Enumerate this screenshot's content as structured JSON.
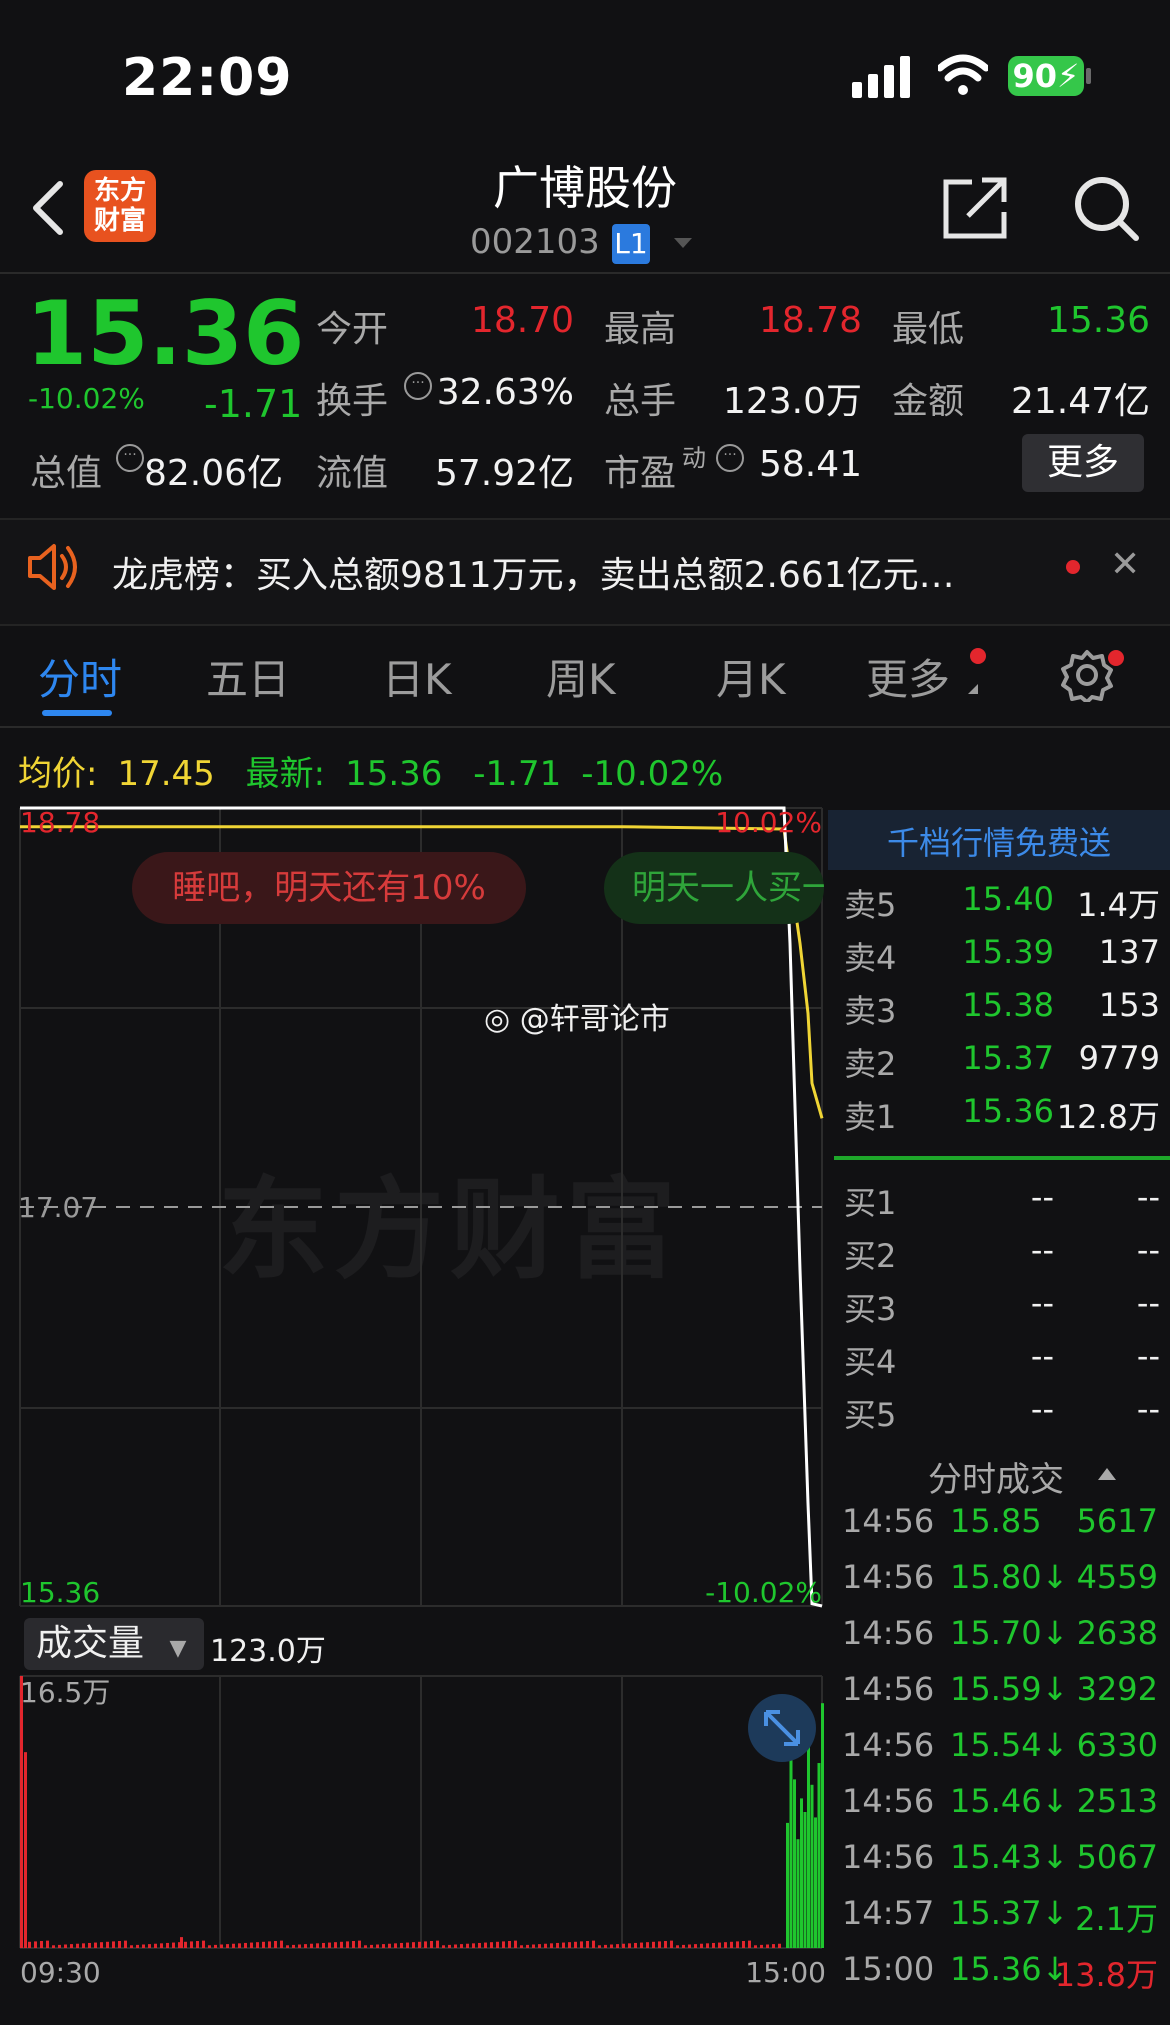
{
  "status_bar": {
    "time": "22:09",
    "battery": "90"
  },
  "header": {
    "brand": "东方财富",
    "title": "广博股份",
    "code": "002103",
    "level": "L1"
  },
  "quote": {
    "price": "15.36",
    "change_pct": "-10.02%",
    "change": "-1.71",
    "rows": [
      [
        {
          "label": "今开",
          "value": "18.70",
          "color": "red"
        },
        {
          "label": "最高",
          "value": "18.78",
          "color": "red"
        },
        {
          "label": "最低",
          "value": "15.36",
          "color": "green"
        }
      ],
      [
        {
          "label": "换手",
          "value": "32.63%",
          "color": "white"
        },
        {
          "label": "总手",
          "value": "123.0万",
          "color": "white"
        },
        {
          "label": "金额",
          "value": "21.47亿",
          "color": "white"
        }
      ],
      [
        {
          "label": "总值",
          "value": "82.06亿",
          "color": "white"
        },
        {
          "label": "流值",
          "value": "57.92亿",
          "color": "white"
        },
        {
          "label": "市盈",
          "value": "58.41",
          "color": "white",
          "sup": "动"
        }
      ]
    ],
    "more": "更多"
  },
  "news": {
    "text": "龙虎榜：买入总额9811万元，卖出总额2.661亿元…"
  },
  "tabs": [
    "分时",
    "五日",
    "日K",
    "周K",
    "月K",
    "更多"
  ],
  "legend": {
    "avg_label": "均价:",
    "avg": "17.45",
    "latest_label": "最新:",
    "latest": "15.36",
    "chg": "-1.71",
    "pct": "-10.02%"
  },
  "chart_labels": {
    "top_price": "18.78",
    "top_pct": "10.02%",
    "mid_price": "17.07",
    "bottom_price": "15.36",
    "bottom_pct": "-10.02%"
  },
  "bubbles": [
    "睡吧，明天还有10%",
    "明天一人买一"
  ],
  "watermarks": {
    "weibo": "@轩哥论市",
    "brand": "东方财富"
  },
  "volume": {
    "label": "成交量",
    "value": "123.0万",
    "max": "16.5万",
    "start_time": "09:30",
    "end_time": "15:00"
  },
  "order_book": {
    "title": "千档行情免费送",
    "asks": [
      {
        "label": "卖5",
        "price": "15.40",
        "vol": "1.4万"
      },
      {
        "label": "卖4",
        "price": "15.39",
        "vol": "137"
      },
      {
        "label": "卖3",
        "price": "15.38",
        "vol": "153"
      },
      {
        "label": "卖2",
        "price": "15.37",
        "vol": "9779"
      },
      {
        "label": "卖1",
        "price": "15.36",
        "vol": "12.8万"
      }
    ],
    "bids": [
      {
        "label": "买1",
        "price": "--",
        "vol": "--"
      },
      {
        "label": "买2",
        "price": "--",
        "vol": "--"
      },
      {
        "label": "买3",
        "price": "--",
        "vol": "--"
      },
      {
        "label": "买4",
        "price": "--",
        "vol": "--"
      },
      {
        "label": "买5",
        "price": "--",
        "vol": "--"
      }
    ]
  },
  "trades": {
    "title": "分时成交",
    "rows": [
      {
        "time": "14:56",
        "price": "15.85",
        "vol": "5617",
        "vol_color": "green"
      },
      {
        "time": "14:56",
        "price": "15.80↓",
        "vol": "4559",
        "vol_color": "green"
      },
      {
        "time": "14:56",
        "price": "15.70↓",
        "vol": "2638",
        "vol_color": "green"
      },
      {
        "time": "14:56",
        "price": "15.59↓",
        "vol": "3292",
        "vol_color": "green"
      },
      {
        "time": "14:56",
        "price": "15.54↓",
        "vol": "6330",
        "vol_color": "green"
      },
      {
        "time": "14:56",
        "price": "15.46↓",
        "vol": "2513",
        "vol_color": "green"
      },
      {
        "time": "14:56",
        "price": "15.43↓",
        "vol": "5067",
        "vol_color": "green"
      },
      {
        "time": "14:57",
        "price": "15.37↓",
        "vol": "2.1万",
        "vol_color": "green"
      },
      {
        "time": "15:00",
        "price": "15.36↓",
        "vol": "13.8万",
        "vol_color": "red"
      }
    ]
  },
  "colors": {
    "up": "#e3262d",
    "down": "#1fc62e",
    "avg_line": "#f0d535",
    "price_line": "#ffffff",
    "accent": "#2e87f0"
  },
  "chart_data": {
    "type": "line",
    "title": "",
    "ylim": [
      15.36,
      18.78
    ],
    "reference_price": 17.07,
    "x": [
      "09:30",
      "10:30",
      "11:30",
      "13:00",
      "14:00",
      "14:53",
      "14:54",
      "14:55",
      "14:56",
      "14:57",
      "15:00"
    ],
    "series": [
      {
        "name": "最新",
        "values": [
          18.78,
          18.78,
          18.78,
          18.78,
          18.78,
          18.78,
          18.2,
          16.8,
          15.8,
          15.37,
          15.36
        ]
      },
      {
        "name": "均价",
        "values": [
          18.7,
          18.7,
          18.7,
          18.7,
          18.7,
          18.69,
          18.5,
          18.2,
          17.9,
          17.6,
          17.45
        ]
      }
    ],
    "volume_max": "16.5万"
  }
}
